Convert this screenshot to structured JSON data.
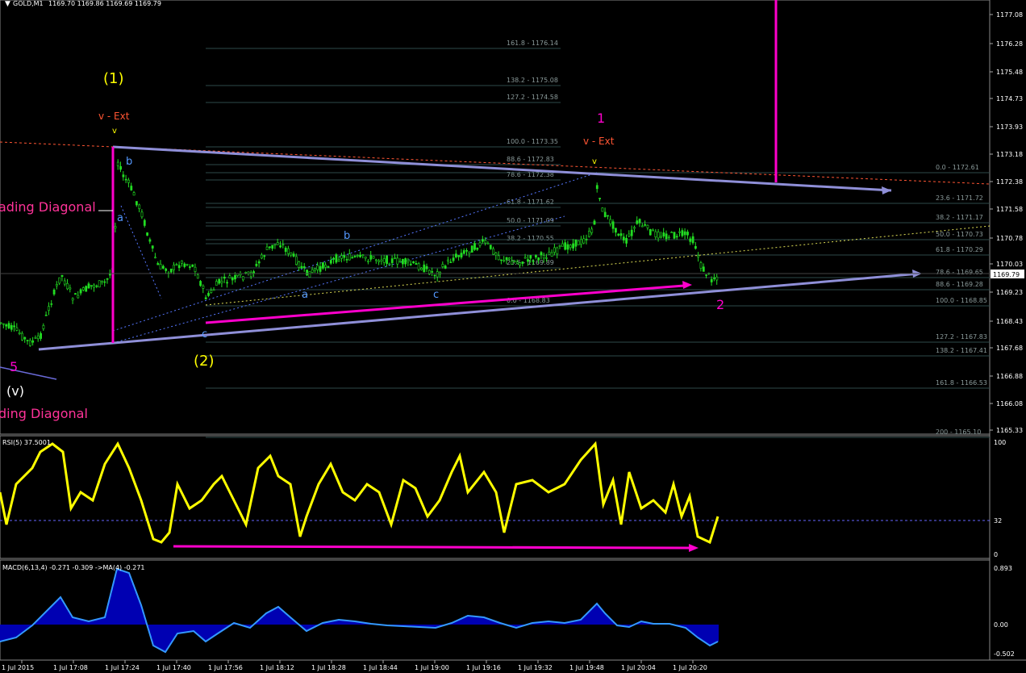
{
  "header": {
    "symbol": "GOLD,M1",
    "ohlc": "1169.70 1169.86 1169.69 1169.79"
  },
  "price_scale": {
    "ticks": [
      "1177.08",
      "1176.28",
      "1175.48",
      "1174.73",
      "1173.93",
      "1173.18",
      "1172.38",
      "1171.58",
      "1170.78",
      "1170.03",
      "1169.23",
      "1168.43",
      "1167.68",
      "1166.88",
      "1166.08",
      "1165.33"
    ],
    "current_price": "1169.79"
  },
  "time_axis": {
    "labels": [
      "1 Jul 2015",
      "1 Jul 17:08",
      "1 Jul 17:24",
      "1 Jul 17:40",
      "1 Jul 17:56",
      "1 Jul 18:12",
      "1 Jul 18:28",
      "1 Jul 18:44",
      "1 Jul 19:00",
      "1 Jul 19:16",
      "1 Jul 19:32",
      "1 Jul 19:48",
      "1 Jul 20:04",
      "1 Jul 20:20"
    ]
  },
  "fib_left": [
    "161.8 - 1176.14",
    "138.2 - 1175.08",
    "127.2 - 1174.58",
    "100.0 - 1173.35",
    "88.6 - 1172.83",
    "78.6 - 1172.38",
    "61.8 - 1171.62",
    "50.0 - 1171.09",
    "38.2 - 1170.55",
    "23.6 - 1169.89",
    "0.0 - 1168.83"
  ],
  "fib_right": [
    "0.0 - 1172.61",
    "23.6 - 1171.72",
    "38.2 - 1171.17",
    "50.0 - 1170.73",
    "61.8 - 1170.29",
    "78.6 - 1169.65",
    "88.6 - 1169.28",
    "100.0 - 1168.85",
    "127.2 - 1167.83",
    "138.2 - 1167.41",
    "161.8 - 1166.53",
    "200 - 1165.10"
  ],
  "wave_labels": {
    "w1_big": "(1)",
    "w2_big": "(2)",
    "v_ext_left": "v - Ext",
    "v_ext_right": "v - Ext",
    "pink_1": "1",
    "pink_2": "2",
    "pink_5": "5",
    "w_v": "(v)",
    "leading_diag": "ading Diagonal",
    "ending_diag": "ding Diagonal",
    "b1": "b",
    "a1": "a",
    "c1": "c",
    "a2": "a",
    "b2": "b",
    "c2": "c",
    "v_small": "v"
  },
  "rsi": {
    "title": "RSI(5) 37.5001",
    "scale": [
      "100",
      "32",
      "0"
    ]
  },
  "macd": {
    "title": "MACD(6,13,4) -0.271 -0.309  ->MA(4) -0.271",
    "scale": [
      "0.893",
      "0.00",
      "-0.502"
    ]
  },
  "colors": {
    "candle": "#22dd22",
    "trendline": "#8f8fd8",
    "magenta": "#ff00cc",
    "fib_line": "#3a5a5a",
    "fib_text": "#8a9a9a",
    "rsi": "#ffff00",
    "macd_line": "#3399ff",
    "macd_hist": "#0000ff"
  }
}
